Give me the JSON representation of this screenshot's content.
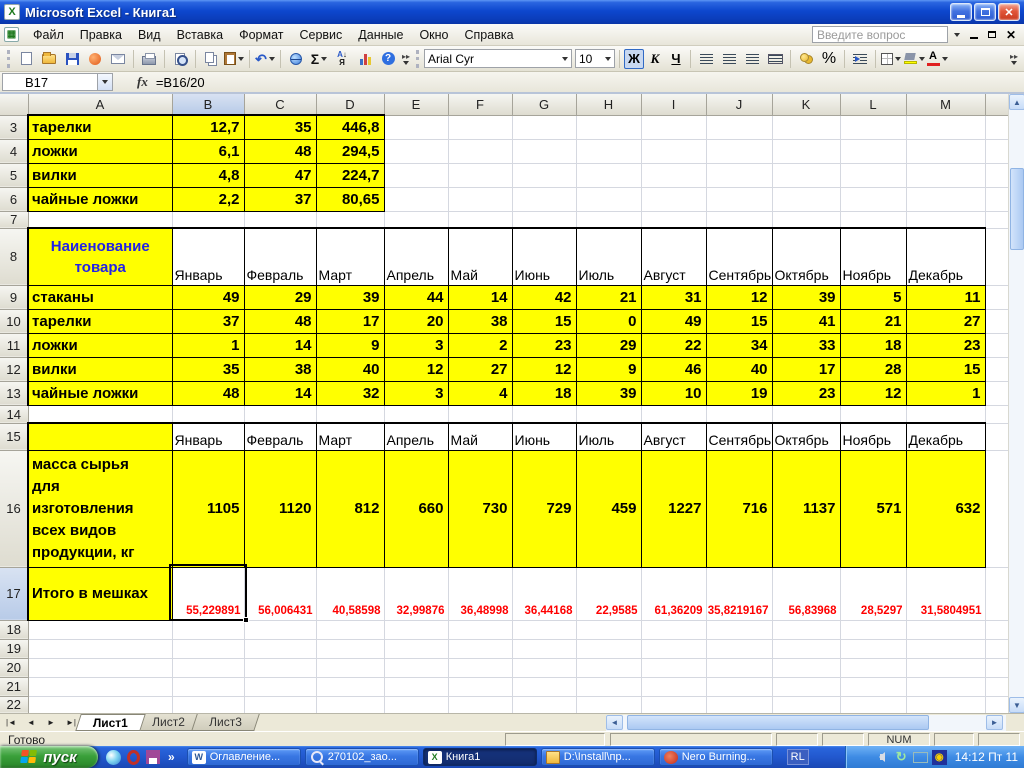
{
  "window": {
    "title": "Microsoft Excel - Книга1"
  },
  "menu": {
    "items": [
      "Файл",
      "Правка",
      "Вид",
      "Вставка",
      "Формат",
      "Сервис",
      "Данные",
      "Окно",
      "Справка"
    ],
    "question_box": "Введите вопрос"
  },
  "toolbar": {
    "font_name": "Arial Cyr",
    "font_size": "10",
    "bold_label": "Ж",
    "italic_label": "К",
    "underline_label": "Ч",
    "sum_label": "Σ",
    "percent_label": "%",
    "font_color_letter": "А",
    "undo_glyph": "↶",
    "sort_top": "А",
    "sort_bottom": "Я",
    "help_label": "?"
  },
  "formula_bar": {
    "name_box": "B17",
    "fx": "fx",
    "formula": "=B16/20"
  },
  "grid": {
    "column_headers": [
      "A",
      "B",
      "C",
      "D",
      "E",
      "F",
      "G",
      "H",
      "I",
      "J",
      "K",
      "L",
      "M"
    ],
    "selected_column": "B",
    "selected_row": 17,
    "months": [
      "Январь",
      "Февраль",
      "Март",
      "Апрель",
      "Май",
      "Июнь",
      "Июль",
      "Август",
      "Сентябрь",
      "Октябрь",
      "Ноябрь",
      "Декабрь"
    ],
    "table1_rows": [
      {
        "label": "тарелки",
        "values": [
          "12,7",
          "35",
          "446,8"
        ]
      },
      {
        "label": "ложки",
        "values": [
          "6,1",
          "48",
          "294,5"
        ]
      },
      {
        "label": "вилки",
        "values": [
          "4,8",
          "47",
          "224,7"
        ]
      },
      {
        "label": "чайные ложки",
        "values": [
          "2,2",
          "37",
          "80,65"
        ]
      }
    ],
    "table2": {
      "header": "Наиенование\nтовара",
      "rows": [
        {
          "label": "стаканы",
          "values": [
            49,
            29,
            39,
            44,
            14,
            42,
            21,
            31,
            12,
            39,
            5,
            11
          ]
        },
        {
          "label": "тарелки",
          "values": [
            37,
            48,
            17,
            20,
            38,
            15,
            0,
            49,
            15,
            41,
            21,
            27
          ]
        },
        {
          "label": "ложки",
          "values": [
            1,
            14,
            9,
            3,
            2,
            23,
            29,
            22,
            34,
            33,
            18,
            23
          ]
        },
        {
          "label": "вилки",
          "values": [
            35,
            38,
            40,
            12,
            27,
            12,
            9,
            46,
            40,
            17,
            28,
            15
          ]
        },
        {
          "label": "чайные ложки",
          "values": [
            48,
            14,
            32,
            3,
            4,
            18,
            39,
            10,
            19,
            23,
            12,
            1
          ]
        }
      ]
    },
    "table3": {
      "mass_label": "масса сырья\nдля\nизготовления\nвсех видов\nпродукции, кг",
      "mass_values": [
        1105,
        1120,
        812,
        660,
        730,
        729,
        459,
        1227,
        716,
        1137,
        571,
        632
      ],
      "total_label": "Итого в мешках",
      "total_values": [
        "55,229891",
        "56,006431",
        "40,58598",
        "32,99876",
        "36,48998",
        "36,44168",
        "22,9585",
        "61,36209",
        "35,8219167",
        "56,83968",
        "28,5297",
        "31,5804951"
      ]
    },
    "empty_rows_top": [
      7,
      14
    ],
    "bottom_rows": [
      18,
      19,
      20,
      21,
      22
    ]
  },
  "sheet_tabs": {
    "items": [
      "Лист1",
      "Лист2",
      "Лист3"
    ],
    "active": "Лист1"
  },
  "status_bar": {
    "left": "Готово",
    "num": "NUM"
  },
  "taskbar": {
    "start": "пуск",
    "quick_launch_more": "»",
    "buttons": [
      {
        "label": "Оглавление...",
        "icon": "word",
        "active": false
      },
      {
        "label": "270102_зао...",
        "icon": "search",
        "active": false
      },
      {
        "label": "Книга1",
        "icon": "excel",
        "active": true
      },
      {
        "label": "D:\\Install\\пр...",
        "icon": "folder",
        "active": false
      },
      {
        "label": "Nero Burning...",
        "icon": "nero",
        "active": false
      }
    ],
    "language": "RL",
    "clock": "14:12 Пт 11"
  }
}
